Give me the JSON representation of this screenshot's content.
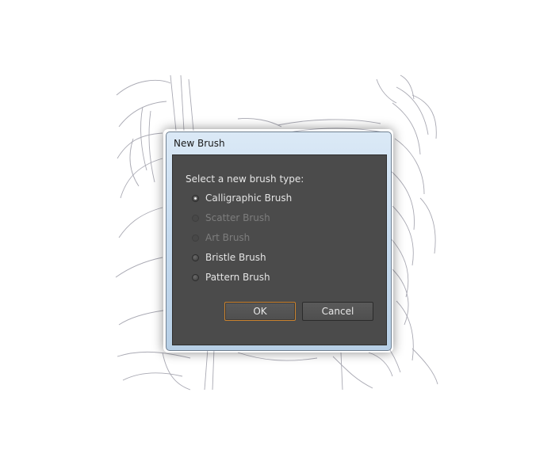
{
  "dialog": {
    "title": "New Brush",
    "prompt": "Select a new brush type:",
    "options": [
      {
        "label": "Calligraphic Brush",
        "checked": true,
        "enabled": true
      },
      {
        "label": "Scatter Brush",
        "checked": false,
        "enabled": false
      },
      {
        "label": "Art Brush",
        "checked": false,
        "enabled": false
      },
      {
        "label": "Bristle Brush",
        "checked": false,
        "enabled": true
      },
      {
        "label": "Pattern Brush",
        "checked": false,
        "enabled": true
      }
    ],
    "ok_label": "OK",
    "cancel_label": "Cancel"
  },
  "colors": {
    "dialog_body": "#4b4b4b",
    "focus_accent": "#c9822e",
    "title_bar": "#c6dbef"
  }
}
